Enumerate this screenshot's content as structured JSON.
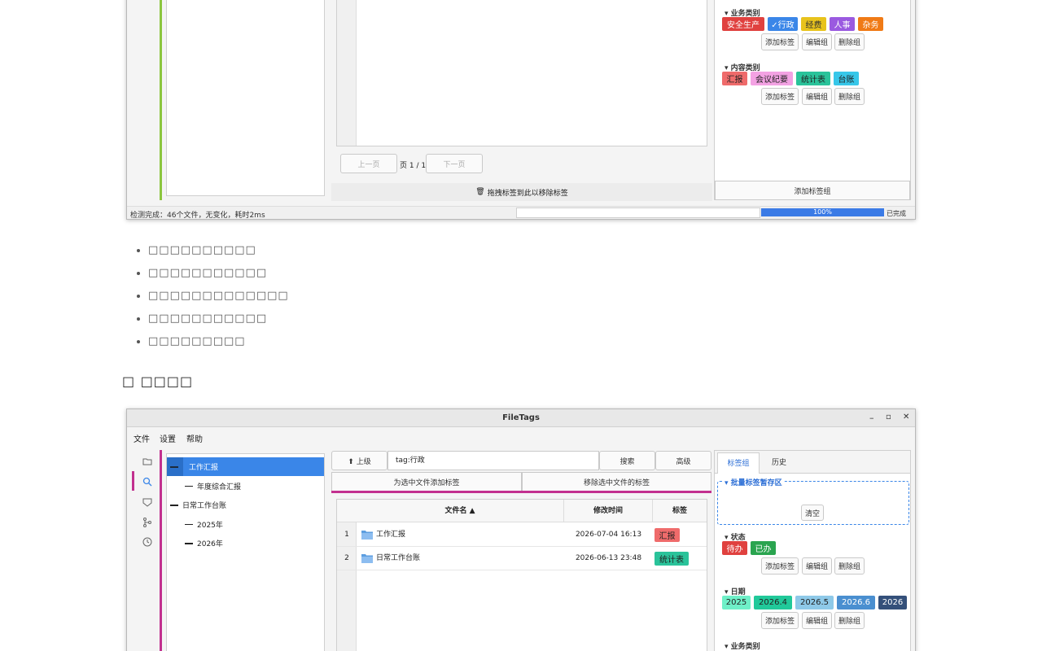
{
  "top_window": {
    "tag_groups": [
      {
        "title": "▾ 业务类别",
        "tags": [
          {
            "label": "安全生产",
            "bg": "#e0413f",
            "fg": "#ffffff"
          },
          {
            "label": "✓行政",
            "bg": "#3a86e8",
            "fg": "#ffffff"
          },
          {
            "label": "经费",
            "bg": "#e8c31c",
            "fg": "#333333"
          },
          {
            "label": "人事",
            "bg": "#9a5ae0",
            "fg": "#ffffff"
          },
          {
            "label": "杂务",
            "bg": "#f07a16",
            "fg": "#ffffff"
          }
        ],
        "actions": [
          "添加标签",
          "编辑组",
          "删除组"
        ]
      },
      {
        "title": "▾ 内容类别",
        "tags": [
          {
            "label": "汇报",
            "bg": "#ef6b6b",
            "fg": "#222222"
          },
          {
            "label": "会议纪要",
            "bg": "#f3a2e3",
            "fg": "#222222"
          },
          {
            "label": "统计表",
            "bg": "#2ac39a",
            "fg": "#222222"
          },
          {
            "label": "台账",
            "bg": "#37c7e9",
            "fg": "#222222"
          }
        ],
        "actions": [
          "添加标签",
          "编辑组",
          "删除组"
        ]
      }
    ],
    "pager": {
      "prev": "上一页",
      "page": "页 1 / 1",
      "next": "下一页"
    },
    "drop_hint": "拖拽标签到此以移除标签",
    "add_group_button": "添加标签组",
    "status_text": "检测完成：46个文件，无变化，耗时2ms",
    "progress": {
      "percent": 100,
      "label": "100%",
      "done": "已完成"
    }
  },
  "bullets": [
    "□□□□□□□□□□",
    "□□□□□□□□□□□",
    "□□□□□□□□□□□□□",
    "□□□□□□□□□□□",
    "□□□□□□□□□"
  ],
  "section_heading": "□ □□□□",
  "bottom_window": {
    "title": "FileTags",
    "window_controls": [
      "–",
      "▫",
      "✕"
    ],
    "menu": [
      "文件",
      "设置",
      "帮助"
    ],
    "tree": [
      {
        "label": "工作汇报",
        "level": 0,
        "selected": true
      },
      {
        "label": "年度综合汇报",
        "level": 1,
        "selected": false
      },
      {
        "label": "日常工作台账",
        "level": 0,
        "selected": false
      },
      {
        "label": "2025年",
        "level": 1,
        "selected": false
      },
      {
        "label": "2026年",
        "level": 1,
        "selected": false
      }
    ],
    "toolbar": {
      "up_button": "⬆ 上级",
      "search_value": "tag:行政",
      "search_button": "搜索",
      "advanced_button": "高级",
      "add_tag_selected": "为选中文件添加标签",
      "remove_tag_selected": "移除选中文件的标签"
    },
    "table": {
      "columns": [
        "文件名 ▲",
        "修改时间",
        "标签"
      ],
      "rows": [
        {
          "index": "1",
          "name": "工作汇报",
          "modified": "2026-07-04 16:13",
          "tag": {
            "label": "汇报",
            "bg": "#ef6b6b"
          }
        },
        {
          "index": "2",
          "name": "日常工作台账",
          "modified": "2026-06-13 23:48",
          "tag": {
            "label": "统计表",
            "bg": "#2ac39a"
          }
        }
      ]
    },
    "right_tabs": [
      "标签组",
      "历史"
    ],
    "staging": {
      "title": "▾ 批量标签暂存区",
      "clear_button": "清空"
    },
    "tag_groups": [
      {
        "title": "▾ 状态",
        "tags": [
          {
            "label": "待办",
            "bg": "#e0413f",
            "fg": "#ffffff"
          },
          {
            "label": "已办",
            "bg": "#2aa44f",
            "fg": "#ffffff"
          }
        ],
        "actions": [
          "添加标签",
          "编辑组",
          "删除组"
        ]
      },
      {
        "title": "▾ 日期",
        "tags": [
          {
            "label": "2025",
            "bg": "#6ff0c8",
            "fg": "#222222"
          },
          {
            "label": "2026.4",
            "bg": "#21c99a",
            "fg": "#222222"
          },
          {
            "label": "2026.5",
            "bg": "#8ec9e8",
            "fg": "#222222"
          },
          {
            "label": "2026.6",
            "bg": "#4a8fd0",
            "fg": "#ffffff"
          },
          {
            "label": "2026",
            "bg": "#34507a",
            "fg": "#ffffff"
          }
        ],
        "actions": [
          "添加标签",
          "编辑组",
          "删除组"
        ]
      },
      {
        "title": "▾ 业务类别",
        "tags": [],
        "actions": []
      }
    ]
  }
}
